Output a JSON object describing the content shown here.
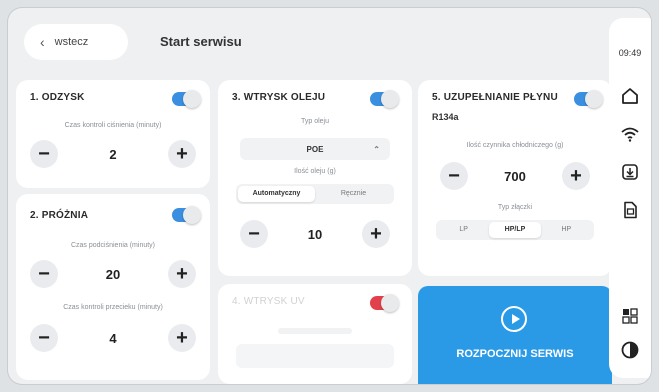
{
  "header": {
    "back_label": "wstecz",
    "title": "Start serwisu"
  },
  "sidebar": {
    "time": "09:49",
    "icons": [
      "home-icon",
      "wifi-icon",
      "download-icon",
      "document-icon",
      "grid-icon",
      "contrast-icon"
    ]
  },
  "recovery": {
    "title": "1. ODZYSK",
    "enabled": true,
    "caption": "Czas kontroli ciśnienia (minuty)",
    "value": "2"
  },
  "vacuum": {
    "title": "2. PRÓŻNIA",
    "enabled": true,
    "caption_1": "Czas podciśnienia (minuty)",
    "value_1": "20",
    "caption_2": "Czas kontroli przecieku (minuty)",
    "value_2": "4"
  },
  "oil": {
    "title": "3. WTRYSK OLEJU",
    "enabled": true,
    "type_caption": "Typ oleju",
    "type_value": "POE",
    "amount_caption": "Ilość oleju (g)",
    "mode_options": [
      "Automatyczny",
      "Ręcznie"
    ],
    "mode_selected": "Automatyczny",
    "value": "10"
  },
  "uv": {
    "title": "4. WTRYSK UV",
    "enabled": false
  },
  "refill": {
    "title": "5. UZUPEŁNIANIE PŁYNU",
    "enabled": true,
    "refrigerant": "R134a",
    "amount_caption": "Ilość czynnika chłodniczego (g)",
    "value": "700",
    "connection_caption": "Typ złączki",
    "connection_options": [
      "LP",
      "HP/LP",
      "HP"
    ],
    "connection_selected": "HP/LP"
  },
  "start": {
    "label": "ROZPOCZNIJ SERWIS"
  },
  "colors": {
    "accent": "#2b9ae6",
    "toggle_on": "#3b8fe0",
    "toggle_off": "#e2414c"
  }
}
